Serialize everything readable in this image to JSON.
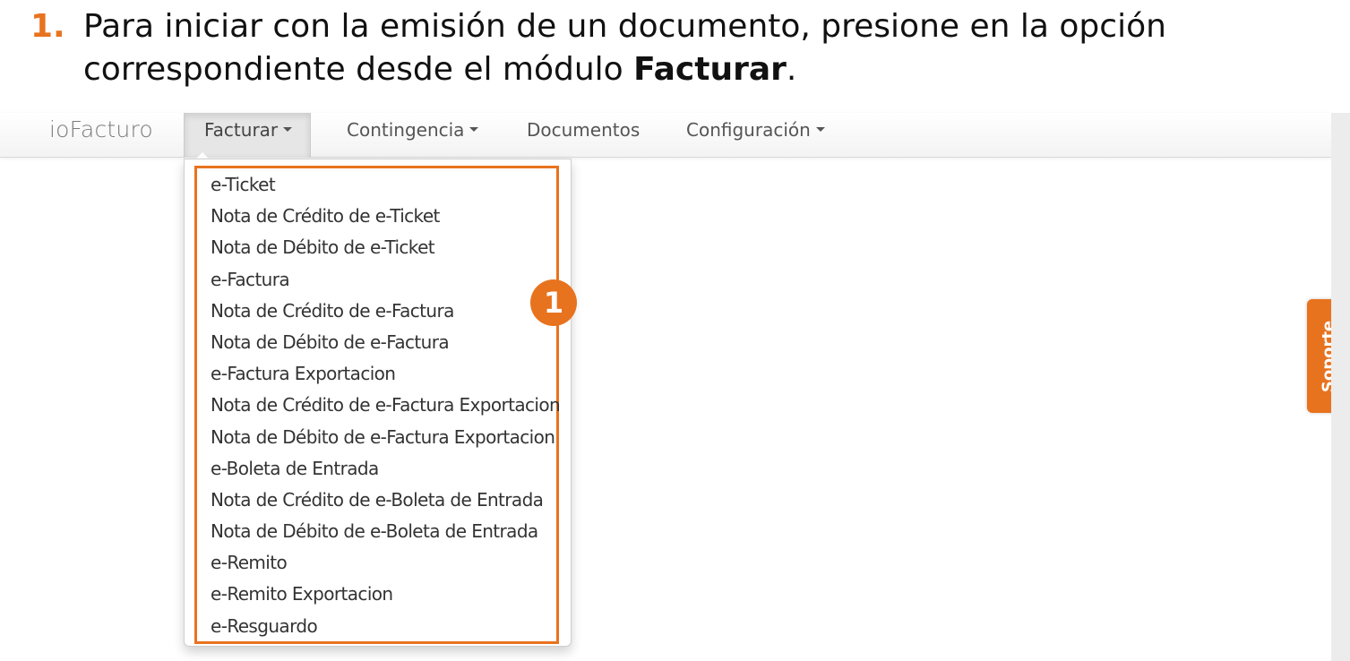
{
  "instruction": {
    "step_number": "1.",
    "text_before": "Para iniciar con la emisión de un documento, presione en la opción correspondiente desde el módulo ",
    "text_bold": "Facturar",
    "text_after": "."
  },
  "navbar": {
    "brand": "ioFacturo",
    "items": [
      {
        "label": "Facturar",
        "dropdown": true,
        "active": true
      },
      {
        "label": "Contingencia",
        "dropdown": true
      },
      {
        "label": "Documentos",
        "dropdown": false
      },
      {
        "label": "Configuración",
        "dropdown": true
      }
    ]
  },
  "dropdown": {
    "items": [
      "e-Ticket",
      "Nota de Crédito de e-Ticket",
      "Nota de Débito de e-Ticket",
      "e-Factura",
      "Nota de Crédito de e-Factura",
      "Nota de Débito de e-Factura",
      "e-Factura Exportacion",
      "Nota de Crédito de e-Factura Exportacion",
      "Nota de Débito de e-Factura Exportacion",
      "e-Boleta de Entrada",
      "Nota de Crédito de e-Boleta de Entrada",
      "Nota de Débito de e-Boleta de Entrada",
      "e-Remito",
      "e-Remito Exportacion",
      "e-Resguardo"
    ]
  },
  "callout_badge": "1",
  "support_tab": "Soporte",
  "colors": {
    "accent": "#e8731f",
    "navbar_bg": "#f3f3f3",
    "active_tab_bg": "#e6e6e6"
  }
}
